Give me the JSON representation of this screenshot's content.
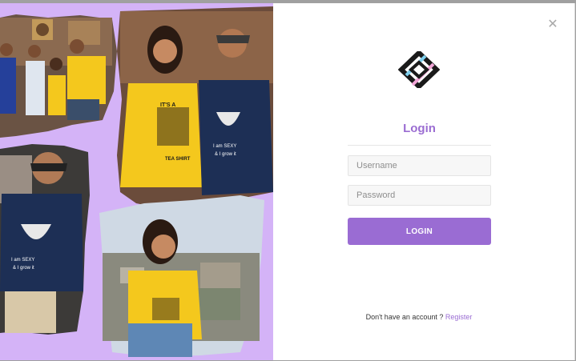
{
  "login": {
    "title": "Login",
    "username_placeholder": "Username",
    "password_placeholder": "Password",
    "submit_label": "LOGIN",
    "signup_prompt": "Don't have an account ?",
    "signup_link": "Register",
    "close_glyph": "✕"
  },
  "shirts": {
    "photo1": "IT'S A",
    "photo1b": "TEA SHIRT",
    "photo2": "I am SEXY",
    "photo2b": "& I grow it",
    "photo3": "I am SEXY",
    "photo3b": "& I grow it"
  },
  "colors": {
    "accent": "#9a6cd3",
    "panel_bg": "#d4b3f7",
    "shirt_yellow": "#f4c81d",
    "shirt_navy": "#1d2f55"
  },
  "icons": [
    "close-icon",
    "brand-logo-icon"
  ]
}
